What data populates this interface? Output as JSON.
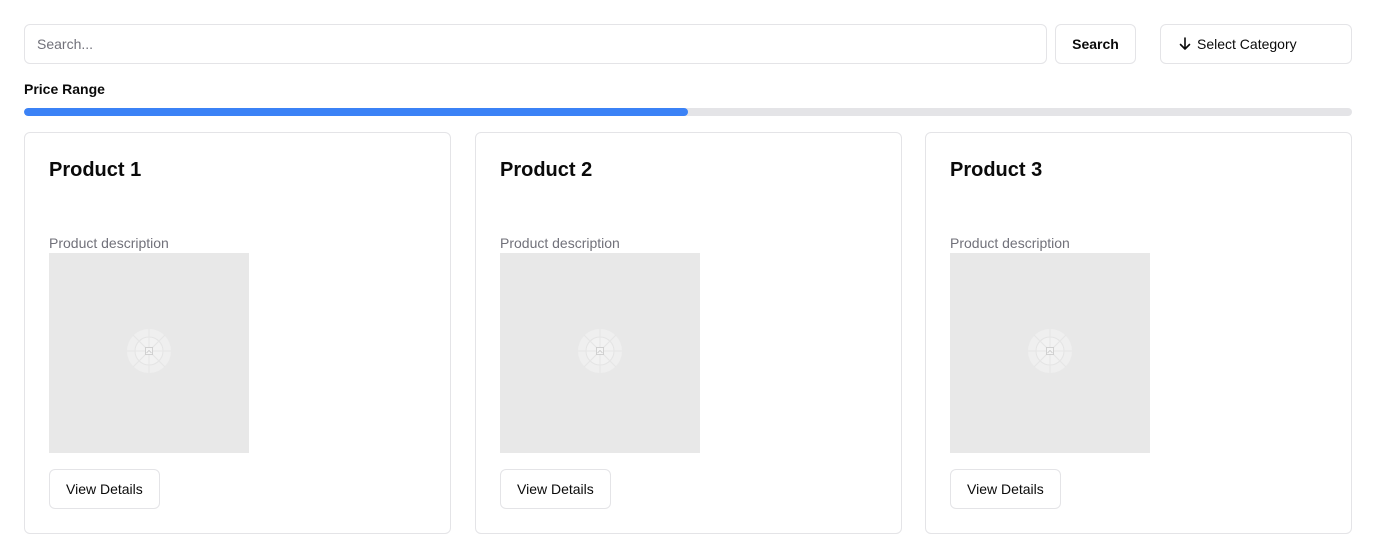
{
  "search": {
    "placeholder": "Search...",
    "value": "",
    "button_label": "Search"
  },
  "category": {
    "label": "Select Category",
    "icon": "arrow-down-icon"
  },
  "price_range": {
    "label": "Price Range",
    "fill_fraction": 0.5
  },
  "colors": {
    "accent": "#3b82f6",
    "track": "#e4e4e7",
    "border": "#e4e4e7",
    "muted_text": "#71717a",
    "image_placeholder": "#e8e8e8"
  },
  "products": [
    {
      "title": "Product 1",
      "description": "Product description",
      "button_label": "View Details",
      "image_icon": "image-placeholder-icon"
    },
    {
      "title": "Product 2",
      "description": "Product description",
      "button_label": "View Details",
      "image_icon": "image-placeholder-icon"
    },
    {
      "title": "Product 3",
      "description": "Product description",
      "button_label": "View Details",
      "image_icon": "image-placeholder-icon"
    }
  ]
}
